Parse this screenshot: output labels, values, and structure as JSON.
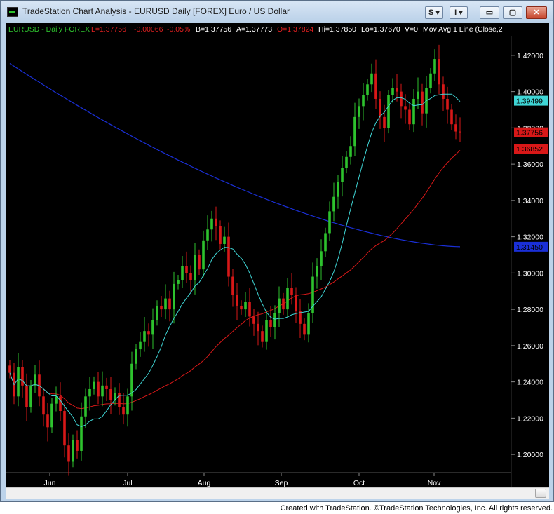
{
  "window": {
    "title": "TradeStation Chart Analysis - EURUSD Daily [FOREX] Euro / US Dollar",
    "s_button": "S ▾",
    "i_button": "I ▾",
    "min": "▭",
    "max": "▢",
    "close": "✕"
  },
  "status": {
    "symbol": "EURUSD - Daily  FOREX",
    "last": "L=1.37756",
    "change": "-0.00066",
    "pct": "-0.05%",
    "bid": "B=1.37756",
    "ask": "A=1.37773",
    "open": "O=1.37824",
    "high": "Hi=1.37850",
    "low": "Lo=1.37670",
    "volume": "V=0",
    "indicator": "Mov Avg 1 Line (Close,2"
  },
  "colors": {
    "background": "#000000",
    "up": "#2ec22e",
    "down": "#d81818",
    "ma_fast": "#3fd6d6",
    "ma_mid": "#d81818",
    "ma_slow": "#1a2fd6",
    "status_symbol": "#2ec22e",
    "status_down": "#e02020"
  },
  "chart_data": {
    "type": "candlestick",
    "ylim": [
      1.19,
      1.43
    ],
    "y_ticks": [
      "1.42000",
      "1.40000",
      "1.38000",
      "1.36000",
      "1.34000",
      "1.32000",
      "1.30000",
      "1.28000",
      "1.26000",
      "1.24000",
      "1.22000",
      "1.20000"
    ],
    "x_labels": [
      "Jun",
      "Jul",
      "Aug",
      "Sep",
      "Oct",
      "Nov"
    ],
    "price_badges": [
      {
        "value": "1.39499",
        "color": "#3fd6d6",
        "text_color": "#000000"
      },
      {
        "value": "1.37756",
        "color": "#d81818",
        "text_color": "#000000"
      },
      {
        "value": "1.36852",
        "color": "#d81818",
        "text_color": "#000000"
      },
      {
        "value": "1.31450",
        "color": "#1a2fd6",
        "text_color": "#000000"
      }
    ],
    "closes": [
      1.245,
      1.232,
      1.248,
      1.238,
      1.226,
      1.238,
      1.244,
      1.232,
      1.222,
      1.215,
      1.228,
      1.232,
      1.224,
      1.205,
      1.196,
      1.208,
      1.202,
      1.221,
      1.232,
      1.236,
      1.24,
      1.232,
      1.238,
      1.236,
      1.23,
      1.234,
      1.226,
      1.222,
      1.232,
      1.25,
      1.258,
      1.262,
      1.268,
      1.266,
      1.274,
      1.282,
      1.28,
      1.286,
      1.28,
      1.294,
      1.296,
      1.304,
      1.3,
      1.296,
      1.31,
      1.302,
      1.318,
      1.324,
      1.33,
      1.326,
      1.316,
      1.32,
      1.298,
      1.288,
      1.282,
      1.28,
      1.284,
      1.276,
      1.272,
      1.268,
      1.262,
      1.274,
      1.27,
      1.278,
      1.286,
      1.28,
      1.292,
      1.288,
      1.279,
      1.272,
      1.266,
      1.278,
      1.298,
      1.304,
      1.312,
      1.322,
      1.334,
      1.342,
      1.35,
      1.358,
      1.364,
      1.37,
      1.386,
      1.392,
      1.398,
      1.404,
      1.41,
      1.396,
      1.386,
      1.38,
      1.398,
      1.402,
      1.4,
      1.392,
      1.39,
      1.382,
      1.396,
      1.4,
      1.388,
      1.402,
      1.41,
      1.418,
      1.404,
      1.396,
      1.39,
      1.382,
      1.378,
      1.3776
    ],
    "ma_fast_end": 1.39499,
    "ma_mid_end": 1.36852,
    "ma_slow_end": 1.3145
  },
  "footer": "Created with TradeStation. ©TradeStation Technologies, Inc. All rights reserved."
}
